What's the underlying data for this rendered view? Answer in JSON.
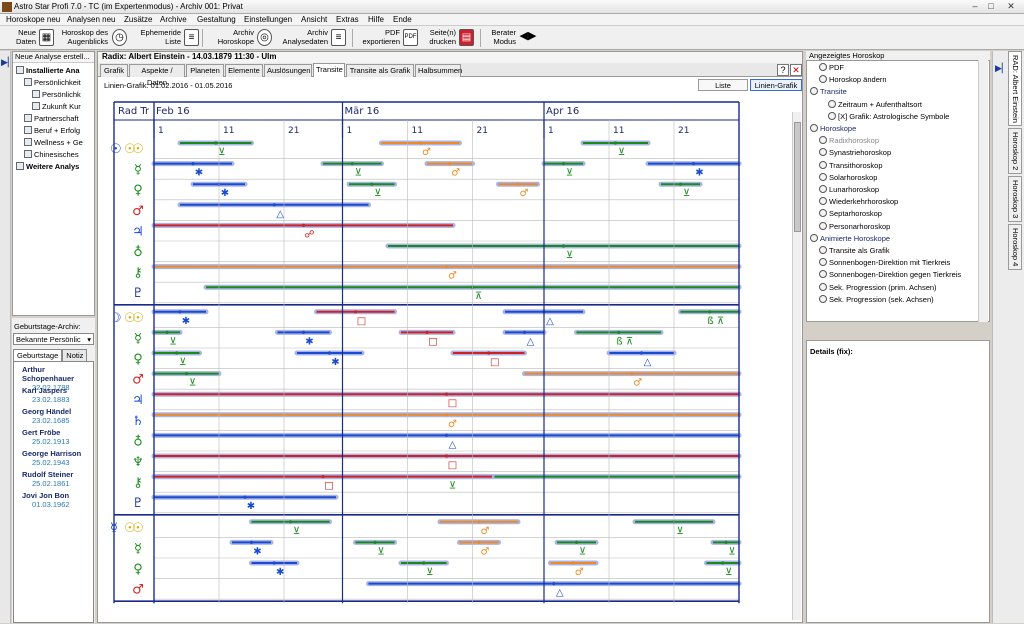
{
  "app": {
    "title": "Astro Star Profi 7.0 - TC (im Expertenmodus) - Archiv 001: Privat"
  },
  "menu": [
    "Horoskope neu",
    "Analysen neu",
    "Zusätze",
    "Archive",
    "Gestaltung",
    "Einstellungen",
    "Ansicht",
    "Extras",
    "Hilfe",
    "Ende"
  ],
  "toolbar": {
    "neue_daten": [
      "Neue",
      "Daten"
    ],
    "horoskop_augenblicks": [
      "Horoskop des",
      "Augenblicks"
    ],
    "ephemeride": [
      "Ephemeride",
      "Liste"
    ],
    "archiv_horoskope": [
      "Archiv",
      "Horoskope"
    ],
    "archiv_analysedaten": [
      "Archiv",
      "Analysedaten"
    ],
    "pdf": [
      "PDF",
      "exportieren"
    ],
    "seiten_drucken": [
      "Seite(n)",
      "drucken"
    ],
    "berater": [
      "Berater",
      "Modus"
    ]
  },
  "left": {
    "header": "Neue Analyse erstell...",
    "tree": [
      {
        "label": "Installierte Ana",
        "level": 0,
        "bold": true
      },
      {
        "label": "Persönlichkeit",
        "level": 1,
        "bold": false
      },
      {
        "label": "Persönlichk",
        "level": 2,
        "bold": false
      },
      {
        "label": "Zukunft Kur",
        "level": 2,
        "bold": false
      },
      {
        "label": "Partnerschaft",
        "level": 1,
        "bold": false
      },
      {
        "label": "Beruf + Erfolg",
        "level": 1,
        "bold": false
      },
      {
        "label": "Wellness + Ge",
        "level": 1,
        "bold": false
      },
      {
        "label": "Chinesisches",
        "level": 1,
        "bold": false
      },
      {
        "label": "Weitere Analys",
        "level": 0,
        "bold": true
      }
    ],
    "archive_label": "Geburtstage-Archiv:",
    "archive_select": "Bekannte Persönlic",
    "tab_geburtstage": "Geburtstage",
    "tab_notiz": "Notiz",
    "birthdays": [
      {
        "name": "Arthur Schopenhauer",
        "date": "22.02.1788"
      },
      {
        "name": "Karl Jaspers",
        "date": "23.02.1883"
      },
      {
        "name": "Georg Händel",
        "date": "23.02.1685"
      },
      {
        "name": "Gert Fröbe",
        "date": "25.02.1913"
      },
      {
        "name": "George Harrison",
        "date": "25.02.1943"
      },
      {
        "name": "Rudolf Steiner",
        "date": "25.02.1861"
      },
      {
        "name": "Jovi Jon Bon",
        "date": "01.03.1962"
      }
    ]
  },
  "center": {
    "header": "Radix: Albert Einstein - 14.03.1879 11:30 - Ulm",
    "tabs": [
      "Grafik",
      "Aspekte / Daten",
      "Planeten",
      "Elemente",
      "Auslösungen",
      "Transite",
      "Transite als Grafik",
      "Halbsummen"
    ],
    "active_tab": "Transite",
    "range": "Linien-Grafik: 01.02.2016 - 01.05.2016",
    "btn_liste": "Liste",
    "btn_linien": "Linien-Grafik",
    "help": "?",
    "close": "✕"
  },
  "chart_data": {
    "type": "table",
    "corner": "Rad Tr",
    "months": [
      {
        "label": "Feb 16",
        "day_index": 0
      },
      {
        "label": "Mär 16",
        "day_index": 29
      },
      {
        "label": "Apr 16",
        "day_index": 60
      }
    ],
    "days_total": 90,
    "day_ticks": [
      {
        "label": "1",
        "d": 0
      },
      {
        "label": "11",
        "d": 10
      },
      {
        "label": "21",
        "d": 20
      },
      {
        "label": "1",
        "d": 29
      },
      {
        "label": "11",
        "d": 39
      },
      {
        "label": "21",
        "d": 49
      },
      {
        "label": "1",
        "d": 60
      },
      {
        "label": "11",
        "d": 70
      },
      {
        "label": "21",
        "d": 80
      }
    ],
    "colors": {
      "sun": "#d4a800",
      "conj": "#1a8a1a",
      "sext": "#1a4ad0",
      "trine": "#1a8a1a",
      "square": "#d02020",
      "opp": "#d02020",
      "orange": "#f08a20"
    },
    "groups": [
      {
        "radix": "☉",
        "transit": "☉",
        "rows": [
          {
            "planet": "☉",
            "col": "#d4a800",
            "bars": [
              {
                "s": 4,
                "e": 15,
                "c": "#1a8a1a",
                "sym": "⊻",
                "sc": "#1a8a1a"
              },
              {
                "s": 35,
                "e": 47,
                "c": "#f08a20",
                "sym": "♂",
                "sc": "#f08a20"
              },
              {
                "s": 66,
                "e": 76,
                "c": "#1a8a1a",
                "sym": "⊻",
                "sc": "#1a8a1a"
              }
            ]
          },
          {
            "planet": "☿",
            "col": "#1a8a1a",
            "bars": [
              {
                "s": 0,
                "e": 12,
                "c": "#1a4ad0",
                "sym": "✱",
                "sc": "#1a4ad0"
              },
              {
                "s": 26,
                "e": 35,
                "c": "#1a8a1a",
                "sym": "⊻",
                "sc": "#1a8a1a"
              },
              {
                "s": 42,
                "e": 49,
                "c": "#f08a20",
                "sym": "♂",
                "sc": "#f08a20"
              },
              {
                "s": 60,
                "e": 66,
                "c": "#1a8a1a",
                "sym": "⊻",
                "sc": "#1a8a1a"
              },
              {
                "s": 76,
                "e": 90,
                "c": "#1a4ad0",
                "sym": "✱",
                "sc": "#1a4ad0"
              }
            ]
          },
          {
            "planet": "♀",
            "col": "#1a8a1a",
            "bars": [
              {
                "s": 6,
                "e": 14,
                "c": "#1a4ad0",
                "sym": "✱",
                "sc": "#1a4ad0"
              },
              {
                "s": 30,
                "e": 37,
                "c": "#1a8a1a",
                "sym": "⊻",
                "sc": "#1a8a1a"
              },
              {
                "s": 53,
                "e": 59,
                "c": "#f08a20",
                "sym": "♂",
                "sc": "#f08a20"
              },
              {
                "s": 78,
                "e": 84,
                "c": "#1a8a1a",
                "sym": "⊻",
                "sc": "#1a8a1a"
              }
            ]
          },
          {
            "planet": "♂",
            "col": "#d02020",
            "bars": [
              {
                "s": 4,
                "e": 33,
                "c": "#1a4ad0",
                "sym": "△",
                "sc": "#1a4ad0"
              }
            ]
          },
          {
            "planet": "♃",
            "col": "#1a4ad0",
            "bars": [
              {
                "s": 0,
                "e": 46,
                "c": "#d02020",
                "sym": "☍",
                "sc": "#d02020"
              }
            ]
          },
          {
            "planet": "♁",
            "col": "#1a8a1a",
            "bars": [
              {
                "s": 36,
                "e": 90,
                "c": "#1a8a1a",
                "sym": "⊻",
                "sc": "#1a8a1a"
              }
            ]
          },
          {
            "planet": "⚷",
            "col": "#1a8a1a",
            "bars": [
              {
                "s": 0,
                "e": 90,
                "c": "#f08a20",
                "sym": "♂",
                "sc": "#f08a20"
              }
            ]
          },
          {
            "planet": "♇",
            "col": "#1a2a9a",
            "bars": [
              {
                "s": 8,
                "e": 90,
                "c": "#1a8a1a",
                "sym": "⊼",
                "sc": "#1a8a1a"
              }
            ]
          }
        ]
      },
      {
        "radix": "☽",
        "transit": "☉",
        "rows": [
          {
            "planet": "☉",
            "col": "#d4a800",
            "bars": [
              {
                "s": 0,
                "e": 8,
                "c": "#1a4ad0",
                "sym": "✱",
                "sc": "#1a4ad0"
              },
              {
                "s": 25,
                "e": 37,
                "c": "#d02020",
                "sym": "□",
                "sc": "#d02020"
              },
              {
                "s": 54,
                "e": 66,
                "c": "#1a4ad0",
                "sym": "△",
                "sc": "#1a4ad0"
              },
              {
                "s": 81,
                "e": 90,
                "c": "#1a8a1a",
                "sym": "ß ⊼",
                "sc": "#1a8a1a"
              }
            ]
          },
          {
            "planet": "☿",
            "col": "#1a8a1a",
            "bars": [
              {
                "s": 0,
                "e": 4,
                "c": "#1a8a1a",
                "sym": "⊻",
                "sc": "#1a8a1a"
              },
              {
                "s": 19,
                "e": 27,
                "c": "#1a4ad0",
                "sym": "✱",
                "sc": "#1a4ad0"
              },
              {
                "s": 38,
                "e": 46,
                "c": "#d02020",
                "sym": "□",
                "sc": "#d02020"
              },
              {
                "s": 54,
                "e": 60,
                "c": "#1a4ad0",
                "sym": "△",
                "sc": "#1a4ad0"
              },
              {
                "s": 65,
                "e": 78,
                "c": "#1a8a1a",
                "sym": "ß ⊼",
                "sc": "#1a8a1a"
              }
            ]
          },
          {
            "planet": "♀",
            "col": "#1a8a1a",
            "bars": [
              {
                "s": 0,
                "e": 7,
                "c": "#1a8a1a",
                "sym": "⊻",
                "sc": "#1a8a1a"
              },
              {
                "s": 22,
                "e": 32,
                "c": "#1a4ad0",
                "sym": "✱",
                "sc": "#1a4ad0"
              },
              {
                "s": 46,
                "e": 57,
                "c": "#d02020",
                "sym": "□",
                "sc": "#d02020"
              },
              {
                "s": 70,
                "e": 80,
                "c": "#1a4ad0",
                "sym": "△",
                "sc": "#1a4ad0"
              }
            ]
          },
          {
            "planet": "♂",
            "col": "#d02020",
            "bars": [
              {
                "s": 0,
                "e": 10,
                "c": "#1a8a1a",
                "sym": "⊻",
                "sc": "#1a8a1a"
              },
              {
                "s": 57,
                "e": 90,
                "c": "#f08a20",
                "sym": "♂",
                "sc": "#f08a20"
              }
            ]
          },
          {
            "planet": "♃",
            "col": "#1a4ad0",
            "bars": [
              {
                "s": 0,
                "e": 90,
                "c": "#d02020",
                "sym": "□",
                "sc": "#d02020"
              }
            ]
          },
          {
            "planet": "♄",
            "col": "#1a4ad0",
            "bars": [
              {
                "s": 0,
                "e": 90,
                "c": "#f08a20",
                "sym": "♂",
                "sc": "#f08a20"
              }
            ]
          },
          {
            "planet": "♁",
            "col": "#1a8a1a",
            "bars": [
              {
                "s": 0,
                "e": 90,
                "c": "#1a4ad0",
                "sym": "△",
                "sc": "#1a4ad0"
              }
            ]
          },
          {
            "planet": "♆",
            "col": "#1a8a1a",
            "bars": [
              {
                "s": 0,
                "e": 90,
                "c": "#d02020",
                "sym": "□",
                "sc": "#d02020"
              }
            ]
          },
          {
            "planet": "⚷",
            "col": "#1a8a1a",
            "bars": [
              {
                "s": 0,
                "e": 90,
                "c": "#1a8a1a",
                "sym": "⊻",
                "sc": "#1a8a1a"
              },
              {
                "s": 0,
                "e": 52,
                "c": "#d02020",
                "sym": "□",
                "sc": "#d02020"
              }
            ]
          },
          {
            "planet": "♇",
            "col": "#1a2a9a",
            "bars": [
              {
                "s": 0,
                "e": 28,
                "c": "#1a4ad0",
                "sym": "✱",
                "sc": "#1a4ad0"
              }
            ]
          }
        ]
      },
      {
        "radix": "☿",
        "transit": "☉",
        "rows": [
          {
            "planet": "☉",
            "col": "#d4a800",
            "bars": [
              {
                "s": 15,
                "e": 27,
                "c": "#1a8a1a",
                "sym": "⊻",
                "sc": "#1a8a1a"
              },
              {
                "s": 44,
                "e": 56,
                "c": "#f08a20",
                "sym": "♂",
                "sc": "#f08a20"
              },
              {
                "s": 74,
                "e": 86,
                "c": "#1a8a1a",
                "sym": "⊻",
                "sc": "#1a8a1a"
              }
            ]
          },
          {
            "planet": "☿",
            "col": "#1a8a1a",
            "bars": [
              {
                "s": 12,
                "e": 18,
                "c": "#1a4ad0",
                "sym": "✱",
                "sc": "#1a4ad0"
              },
              {
                "s": 31,
                "e": 37,
                "c": "#1a8a1a",
                "sym": "⊻",
                "sc": "#1a8a1a"
              },
              {
                "s": 47,
                "e": 53,
                "c": "#f08a20",
                "sym": "♂",
                "sc": "#f08a20"
              },
              {
                "s": 62,
                "e": 68,
                "c": "#1a8a1a",
                "sym": "⊻",
                "sc": "#1a8a1a"
              },
              {
                "s": 86,
                "e": 90,
                "c": "#1a8a1a",
                "sym": "⊻",
                "sc": "#1a8a1a"
              }
            ]
          },
          {
            "planet": "♀",
            "col": "#1a8a1a",
            "bars": [
              {
                "s": 15,
                "e": 22,
                "c": "#1a4ad0",
                "sym": "✱",
                "sc": "#1a4ad0"
              },
              {
                "s": 38,
                "e": 45,
                "c": "#1a8a1a",
                "sym": "⊻",
                "sc": "#1a8a1a"
              },
              {
                "s": 61,
                "e": 68,
                "c": "#f08a20",
                "sym": "♂",
                "sc": "#f08a20"
              },
              {
                "s": 85,
                "e": 90,
                "c": "#1a8a1a",
                "sym": "⊻",
                "sc": "#1a8a1a"
              }
            ]
          },
          {
            "planet": "♂",
            "col": "#d02020",
            "bars": [
              {
                "s": 33,
                "e": 90,
                "c": "#1a4ad0",
                "sym": "△",
                "sc": "#1a4ad0"
              }
            ]
          }
        ]
      }
    ]
  },
  "right": {
    "header": "Angezeigtes Horoskop",
    "items": [
      {
        "label": "PDF",
        "type": "item",
        "ind": 1
      },
      {
        "label": "Horoskop ändern",
        "type": "item",
        "ind": 1
      },
      {
        "label": "Transite",
        "type": "grp",
        "ind": 0
      },
      {
        "label": "Zeitraum + Aufenthaltsort",
        "type": "item",
        "ind": 2
      },
      {
        "label": "[X] Grafik: Astrologische Symbole",
        "type": "item",
        "ind": 2
      },
      {
        "label": "Horoskope",
        "type": "grp",
        "ind": 0
      },
      {
        "label": "Radixhoroskop",
        "type": "dis",
        "ind": 1
      },
      {
        "label": "Synastriehoroskop",
        "type": "item",
        "ind": 1
      },
      {
        "label": "Transithoroskop",
        "type": "item",
        "ind": 1
      },
      {
        "label": "Solarhoroskop",
        "type": "item",
        "ind": 1
      },
      {
        "label": "Lunarhoroskop",
        "type": "item",
        "ind": 1
      },
      {
        "label": "Wiederkehrhoroskop",
        "type": "item",
        "ind": 1
      },
      {
        "label": "Septarhoroskop",
        "type": "item",
        "ind": 1
      },
      {
        "label": "Personarhoroskop",
        "type": "item",
        "ind": 1
      },
      {
        "label": "Animierte Horoskope",
        "type": "grp",
        "ind": 0
      },
      {
        "label": "Transite als Grafik",
        "type": "item",
        "ind": 1
      },
      {
        "label": "Sonnenbogen-Direktion mit Tierkreis",
        "type": "item",
        "ind": 1
      },
      {
        "label": "Sonnenbogen-Direktion gegen Tierkreis",
        "type": "item",
        "ind": 1
      },
      {
        "label": "Sek. Progression (prim. Achsen)",
        "type": "item",
        "ind": 1
      },
      {
        "label": "Sek. Progression (sek. Achsen)",
        "type": "item",
        "ind": 1
      }
    ],
    "details": "Details (fix):"
  },
  "side_tabs": [
    "RAD: Albert Einstein",
    "Horoskop 2",
    "Horoskop 3",
    "Horoskop 4"
  ]
}
